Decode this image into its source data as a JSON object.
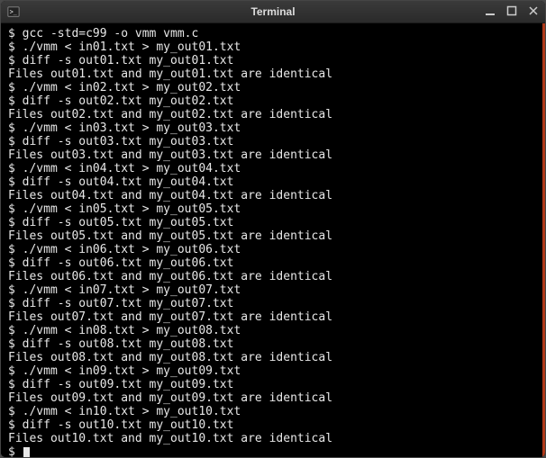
{
  "window": {
    "title": "Terminal",
    "icon": "terminal-icon",
    "controls": {
      "minimize": "—",
      "maximize": "□",
      "close": "×"
    }
  },
  "terminal": {
    "prompt": "$ ",
    "lines": [
      "$ gcc -std=c99 -o vmm vmm.c",
      "$ ./vmm < in01.txt > my_out01.txt",
      "$ diff -s out01.txt my_out01.txt",
      "Files out01.txt and my_out01.txt are identical",
      "$ ./vmm < in02.txt > my_out02.txt",
      "$ diff -s out02.txt my_out02.txt",
      "Files out02.txt and my_out02.txt are identical",
      "$ ./vmm < in03.txt > my_out03.txt",
      "$ diff -s out03.txt my_out03.txt",
      "Files out03.txt and my_out03.txt are identical",
      "$ ./vmm < in04.txt > my_out04.txt",
      "$ diff -s out04.txt my_out04.txt",
      "Files out04.txt and my_out04.txt are identical",
      "$ ./vmm < in05.txt > my_out05.txt",
      "$ diff -s out05.txt my_out05.txt",
      "Files out05.txt and my_out05.txt are identical",
      "$ ./vmm < in06.txt > my_out06.txt",
      "$ diff -s out06.txt my_out06.txt",
      "Files out06.txt and my_out06.txt are identical",
      "$ ./vmm < in07.txt > my_out07.txt",
      "$ diff -s out07.txt my_out07.txt",
      "Files out07.txt and my_out07.txt are identical",
      "$ ./vmm < in08.txt > my_out08.txt",
      "$ diff -s out08.txt my_out08.txt",
      "Files out08.txt and my_out08.txt are identical",
      "$ ./vmm < in09.txt > my_out09.txt",
      "$ diff -s out09.txt my_out09.txt",
      "Files out09.txt and my_out09.txt are identical",
      "$ ./vmm < in10.txt > my_out10.txt",
      "$ diff -s out10.txt my_out10.txt",
      "Files out10.txt and my_out10.txt are identical"
    ]
  }
}
